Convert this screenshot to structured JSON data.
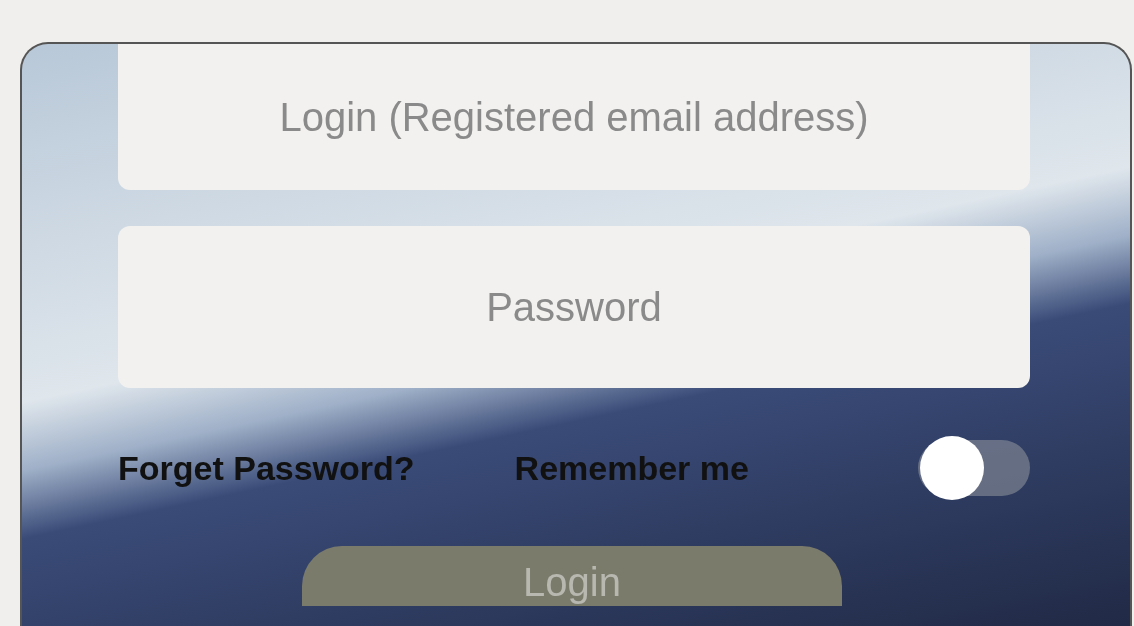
{
  "login_form": {
    "email_field": {
      "placeholder": "Login (Registered email address)"
    },
    "password_field": {
      "placeholder": "Password"
    },
    "forgot_link": "Forget Password?",
    "remember_me": {
      "label": "Remember me",
      "on": false
    },
    "login_button": "Login"
  }
}
